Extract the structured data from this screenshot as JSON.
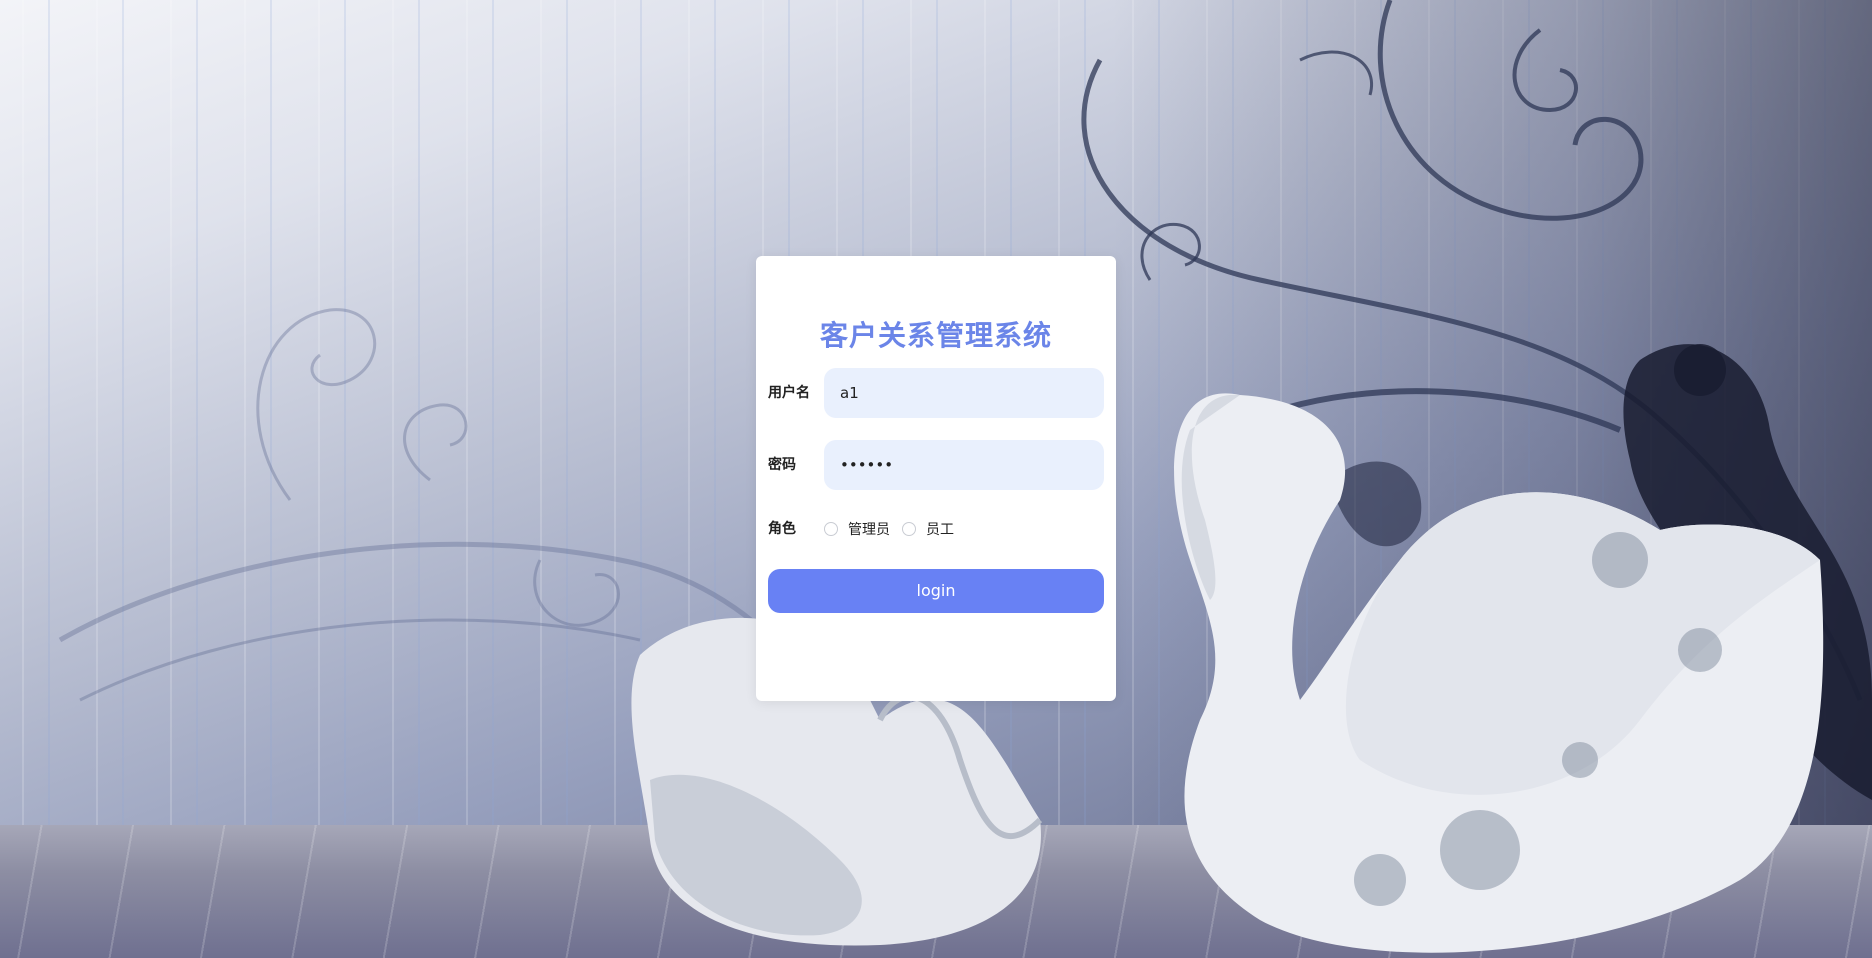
{
  "login": {
    "title": "客户关系管理系统",
    "username": {
      "label": "用户名",
      "value": "a1"
    },
    "password": {
      "label": "密码",
      "value": "••••••"
    },
    "role": {
      "label": "角色",
      "options": [
        "管理员",
        "员工"
      ],
      "selected": null
    },
    "button_label": "login"
  },
  "theme": {
    "accent": "#6881f4",
    "title_color": "#6b85e8",
    "input_bg": "#e9f0fd"
  }
}
